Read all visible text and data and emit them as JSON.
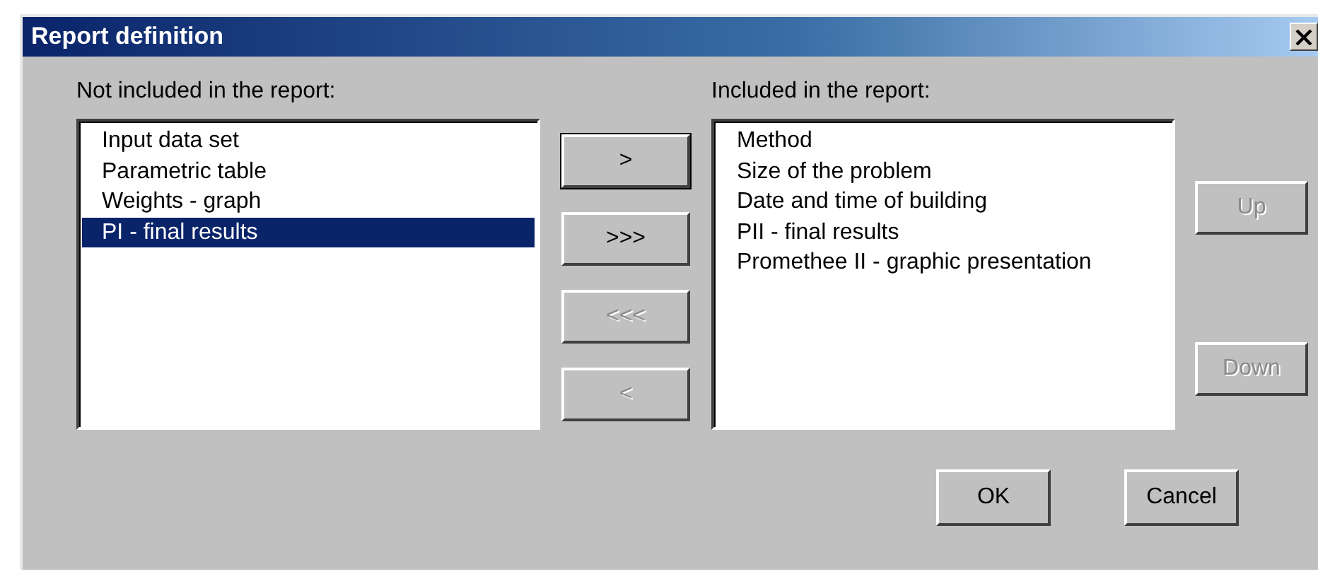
{
  "window": {
    "title": "Report definition"
  },
  "available": {
    "label": "Not included in the report:",
    "items": [
      {
        "text": "Input data set",
        "selected": false
      },
      {
        "text": "Parametric table",
        "selected": false
      },
      {
        "text": "Weights - graph",
        "selected": false
      },
      {
        "text": "PI - final results",
        "selected": true
      }
    ]
  },
  "transfer_buttons": [
    {
      "label": ">",
      "disabled": false,
      "focused": true
    },
    {
      "label": ">>>",
      "disabled": false,
      "focused": false
    },
    {
      "label": "<<<",
      "disabled": true,
      "focused": false
    },
    {
      "label": "<",
      "disabled": true,
      "focused": false
    }
  ],
  "included": {
    "label": "Included in the report:",
    "items": [
      {
        "text": "Method",
        "selected": false
      },
      {
        "text": "Size of the problem",
        "selected": false
      },
      {
        "text": "Date and time of building",
        "selected": false
      },
      {
        "text": "PII - final results",
        "selected": false
      },
      {
        "text": "Promethee II - graphic presentation",
        "selected": false
      }
    ]
  },
  "order_buttons": [
    {
      "label": "Up",
      "disabled": true
    },
    {
      "label": "Down",
      "disabled": true
    }
  ],
  "buttons": [
    {
      "label": "OK"
    },
    {
      "label": "Cancel"
    }
  ]
}
